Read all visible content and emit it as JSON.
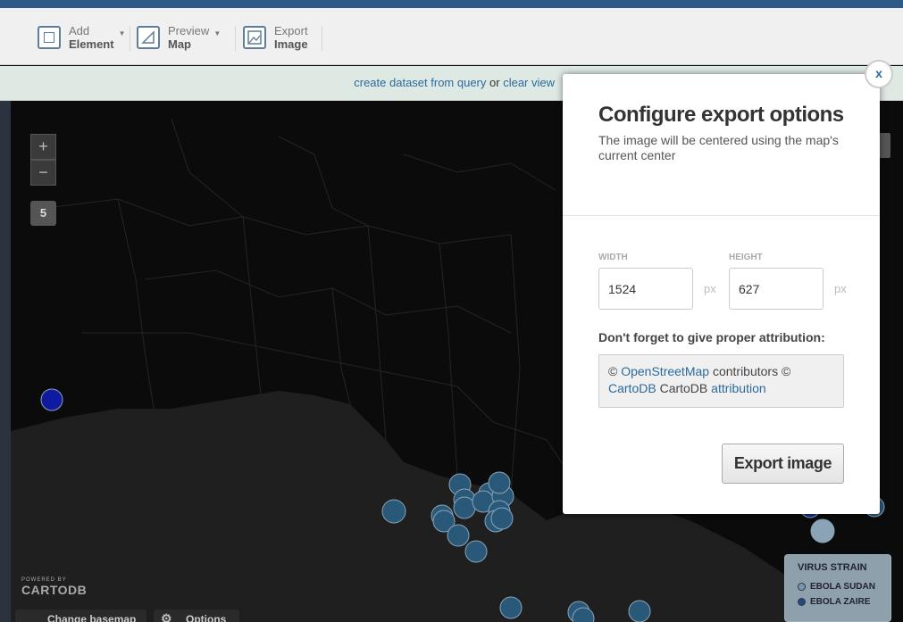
{
  "toolbar": {
    "add_element": {
      "line1": "Add",
      "line2": "Element"
    },
    "preview_map": {
      "line1": "Preview",
      "line2": "Map"
    },
    "export_image": {
      "line1": "Export",
      "line2": "Image"
    }
  },
  "infobar": {
    "create_link": "create dataset from query",
    "or_text": "or",
    "clear_link": "clear view"
  },
  "map": {
    "zoom_in": "+",
    "zoom_out": "−",
    "zoom_level": "5",
    "logo_small": "POWERED BY",
    "logo_big": "CARTODB",
    "change_basemap": "Change basemap",
    "options": "Options",
    "legend": {
      "title": "VIRUS STRAIN",
      "items": [
        {
          "label": "EBOLA SUDAN",
          "color": "#7a97ad"
        },
        {
          "label": "EBOLA ZAIRE",
          "color": "#1f4d78"
        }
      ]
    }
  },
  "dialog": {
    "title": "Configure export options",
    "subtitle": "The image will be centered using the map's current center",
    "width_label": "WIDTH",
    "width_value": "1524",
    "height_label": "HEIGHT",
    "height_value": "627",
    "unit": "px",
    "attribution_label": "Don't forget to give proper attribution:",
    "attribution": {
      "prefix": "© ",
      "osm_link": "OpenStreetMap",
      "middle": " contributors © ",
      "carto_link": "CartoDB",
      "carto_text": " CartoDB ",
      "attr_link": "attribution"
    },
    "export_button": "Export image",
    "close": "x"
  },
  "colors": {
    "accent": "#2a6a9e",
    "map_bg": "#131313",
    "point": "#2a5878"
  }
}
